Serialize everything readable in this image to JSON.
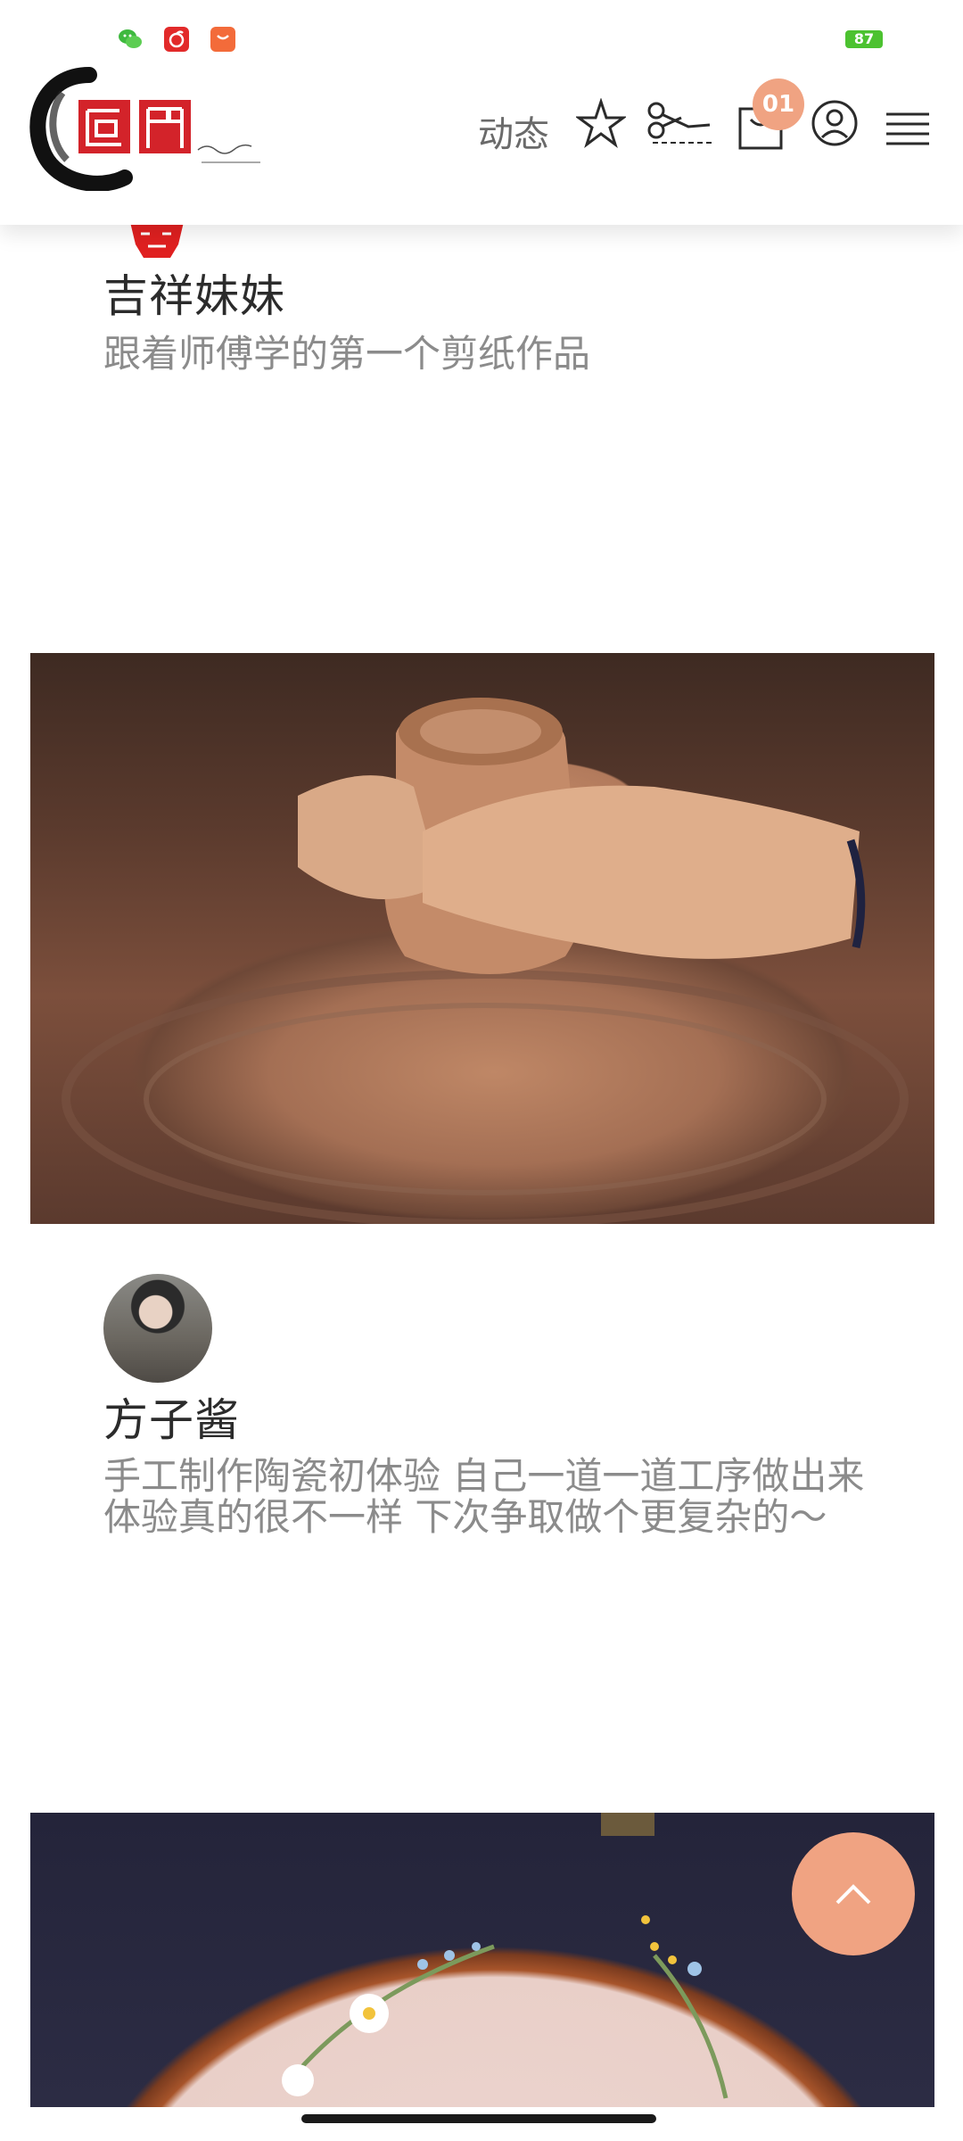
{
  "status_bar": {
    "battery": "87",
    "icons": [
      "wechat-icon",
      "netease-music-icon",
      "shopping-bag-icon"
    ]
  },
  "header": {
    "logo_icon": "jiangmen-logo-icon",
    "nav_dynamic": "动态",
    "icons": [
      "star-icon",
      "scissors-icon",
      "shopping-bag-icon",
      "user-icon",
      "menu-icon"
    ],
    "cart_count": "01"
  },
  "feed": {
    "posts": [
      {
        "author": "吉祥妹妹",
        "caption": "跟着师傅学的第一个剪纸作品"
      },
      {
        "image": "pottery-wheel-photo",
        "author": "方子酱",
        "caption_line1": "手工制作陶瓷初体验 自己一道一道工序做出来",
        "caption_line2": "体验真的很不一样 下次争取做个更复杂的～"
      },
      {
        "image": "embroidery-hoop-photo"
      }
    ]
  },
  "colors": {
    "accent": "#f0a382",
    "logo_red": "#d3232a",
    "caption_gray": "#8b8b8b"
  },
  "floating": {
    "back_to_top_icon": "chevron-up-icon"
  }
}
